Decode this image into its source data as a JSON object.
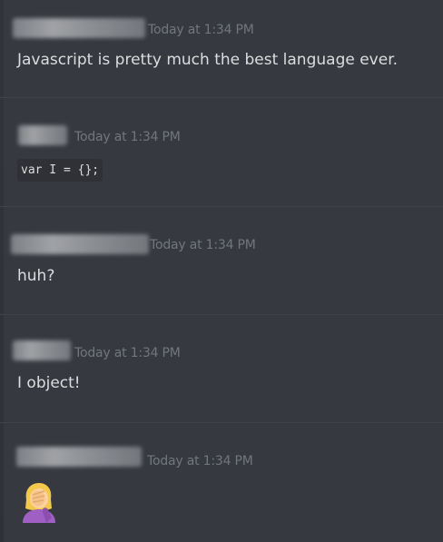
{
  "messages": [
    {
      "timestamp": "Today at 1:34 PM",
      "text": "Javascript is pretty much the best language ever."
    },
    {
      "timestamp": "Today at 1:34 PM",
      "code": "var I = {};"
    },
    {
      "timestamp": "Today at 1:34 PM",
      "text": "huh?"
    },
    {
      "timestamp": "Today at 1:34 PM",
      "text": "I object!"
    },
    {
      "timestamp": "Today at 1:34 PM",
      "emoji": "woman-facepalming-emoji"
    }
  ]
}
